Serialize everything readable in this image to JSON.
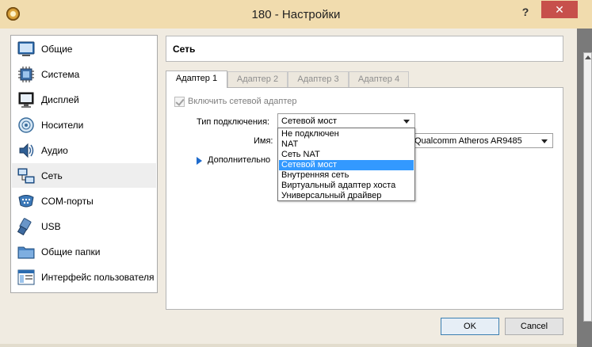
{
  "window": {
    "title": "180 - Настройки",
    "help_glyph": "?",
    "close_glyph": "✕"
  },
  "sidebar": {
    "items": [
      {
        "label": "Общие",
        "icon": "general-icon"
      },
      {
        "label": "Система",
        "icon": "system-icon"
      },
      {
        "label": "Дисплей",
        "icon": "display-icon"
      },
      {
        "label": "Носители",
        "icon": "storage-icon"
      },
      {
        "label": "Аудио",
        "icon": "audio-icon"
      },
      {
        "label": "Сеть",
        "icon": "network-icon",
        "selected": true
      },
      {
        "label": "COM-порты",
        "icon": "serial-ports-icon"
      },
      {
        "label": "USB",
        "icon": "usb-icon"
      },
      {
        "label": "Общие папки",
        "icon": "shared-folders-icon"
      },
      {
        "label": "Интерфейс пользователя",
        "icon": "user-interface-icon"
      }
    ]
  },
  "main": {
    "section_title": "Сеть",
    "tabs": [
      {
        "label": "Адаптер 1",
        "active": true
      },
      {
        "label": "Адаптер 2"
      },
      {
        "label": "Адаптер 3"
      },
      {
        "label": "Адаптер 4"
      }
    ],
    "enable_adapter": {
      "label": "Включить сетевой адаптер",
      "checked": true,
      "disabled": true
    },
    "attached_to": {
      "label": "Тип подключения:",
      "value": "Сетевой мост",
      "options": [
        "Не подключен",
        "NAT",
        "Сеть NAT",
        "Сетевой мост",
        "Внутренняя сеть",
        "Виртуальный адаптер хоста",
        "Универсальный драйвер"
      ],
      "highlighted": "Сетевой мост"
    },
    "name": {
      "label": "Имя:",
      "value": "Qualcomm Atheros AR9485"
    },
    "advanced_label": "Дополнительно"
  },
  "buttons": {
    "ok": "OK",
    "cancel": "Cancel"
  },
  "colors": {
    "titlebar": "#f1dcae",
    "close_button": "#c7504b",
    "highlight": "#3399ff",
    "advanced_arrow": "#1e6bcc"
  }
}
